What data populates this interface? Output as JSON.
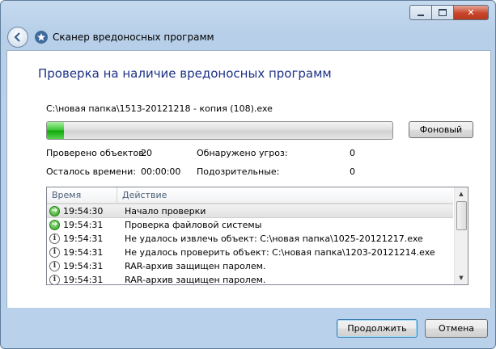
{
  "window": {
    "title": "Сканер вредоносных программ",
    "controls": {
      "minimize": "minimize",
      "maximize": "maximize",
      "close": "close"
    }
  },
  "main": {
    "heading": "Проверка на наличие вредоносных программ",
    "current_file": "C:\\новая папка\\1513-20121218 - копия (108).exe",
    "progress": 0.05,
    "background_button": "Фоновый"
  },
  "stats": {
    "checked_label": "Проверено объектов:",
    "checked_value": "20",
    "threats_label": "Обнаружено угроз:",
    "threats_value": "0",
    "remaining_label": "Осталось времени:",
    "remaining_value": "00:00:00",
    "suspicious_label": "Подозрительные:",
    "suspicious_value": "0"
  },
  "log": {
    "columns": {
      "time": "Время",
      "action": "Действие"
    },
    "rows": [
      {
        "icon": "ok",
        "time": "19:54:30",
        "action": "Начало проверки"
      },
      {
        "icon": "ok",
        "time": "19:54:31",
        "action": "Проверка файловой системы"
      },
      {
        "icon": "info",
        "time": "19:54:31",
        "action": "Не удалось извлечь объект: C:\\новая папка\\1025-20121217.exe"
      },
      {
        "icon": "info",
        "time": "19:54:31",
        "action": "Не удалось проверить объект: C:\\новая папка\\1203-20121214.exe"
      },
      {
        "icon": "info",
        "time": "19:54:31",
        "action": "RAR-архив защищен паролем."
      },
      {
        "icon": "info",
        "time": "19:54:31",
        "action": "RAR-архив защищен паролем."
      }
    ]
  },
  "footer": {
    "continue": "Продолжить",
    "cancel": "Отмена"
  },
  "colors": {
    "heading": "#1e3287",
    "progress_fill": "#37c331",
    "frame": "#b9d1ea"
  }
}
